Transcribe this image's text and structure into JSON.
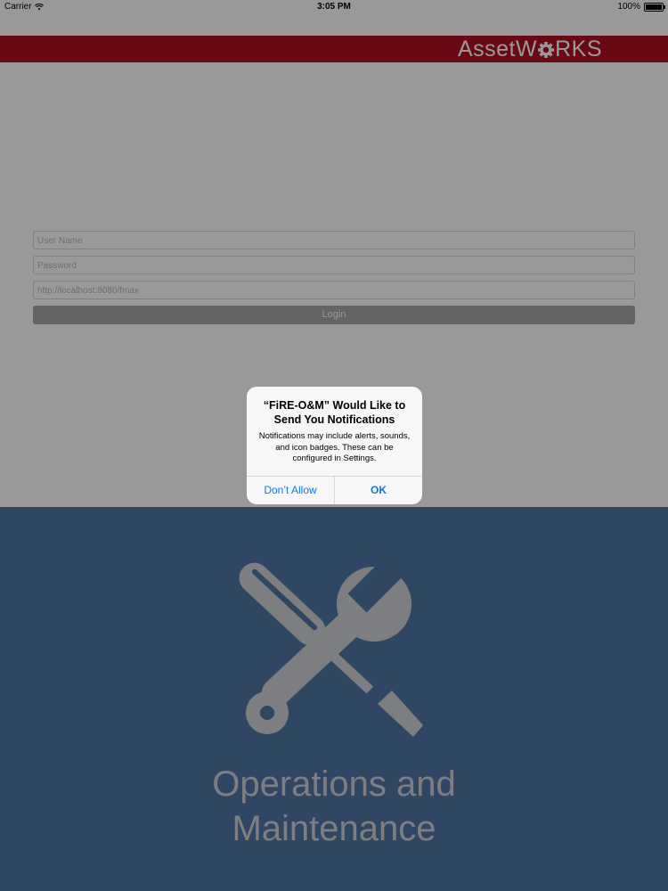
{
  "status_bar": {
    "carrier": "Carrier",
    "time": "3:05 PM",
    "battery": "100%"
  },
  "header": {
    "logo_left": "AssetW",
    "logo_right": "RKS",
    "accent": "#b01020"
  },
  "login_form": {
    "username_placeholder": "User Name",
    "password_placeholder": "Password",
    "server_url": "http://localhost:8080/fmax",
    "login_label": "Login"
  },
  "panel": {
    "title_line1": "Operations and",
    "title_line2": "Maintenance",
    "icon": "wrench-screwdriver-icon",
    "color": "#4f77a3"
  },
  "alert": {
    "title": "“FiRE-O&M” Would Like to Send You Notifications",
    "message": "Notifications may include alerts, sounds, and icon badges. These can be configured in Settings.",
    "buttons": {
      "deny": "Don’t Allow",
      "ok": "OK"
    }
  }
}
